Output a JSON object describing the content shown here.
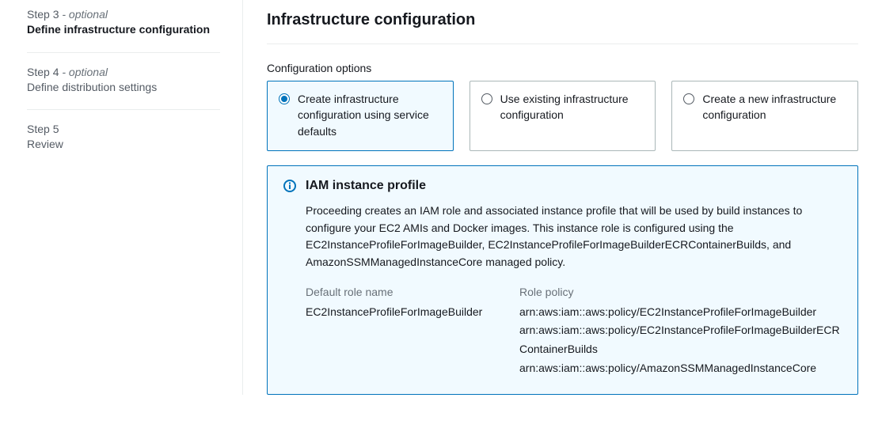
{
  "sidebar": {
    "steps": [
      {
        "label": "Step 3",
        "optional": "- optional",
        "title": "Define infrastructure configuration",
        "active": true
      },
      {
        "label": "Step 4",
        "optional": "- optional",
        "title": "Define distribution settings",
        "active": false
      },
      {
        "label": "Step 5",
        "optional": "",
        "title": "Review",
        "active": false
      }
    ]
  },
  "main": {
    "title": "Infrastructure configuration",
    "section_label": "Configuration options",
    "options": [
      {
        "label": "Create infrastructure configuration using service defaults",
        "selected": true
      },
      {
        "label": "Use existing infrastructure configuration",
        "selected": false
      },
      {
        "label": "Create a new infrastructure configuration",
        "selected": false
      }
    ],
    "info": {
      "title": "IAM instance profile",
      "description": "Proceeding creates an IAM role and associated instance profile that will be used by build instances to configure your EC2 AMIs and Docker images. This instance role is configured using the EC2InstanceProfileForImageBuilder, EC2InstanceProfileForImageBuilderECRContainerBuilds, and AmazonSSMManagedInstanceCore managed policy.",
      "role_name_label": "Default role name",
      "role_name_value": "EC2InstanceProfileForImageBuilder",
      "role_policy_label": "Role policy",
      "role_policy_values": [
        "arn:aws:iam::aws:policy/EC2InstanceProfileForImageBuilder",
        "arn:aws:iam::aws:policy/EC2InstanceProfileForImageBuilderECRContainerBuilds",
        "arn:aws:iam::aws:policy/AmazonSSMManagedInstanceCore"
      ]
    }
  }
}
